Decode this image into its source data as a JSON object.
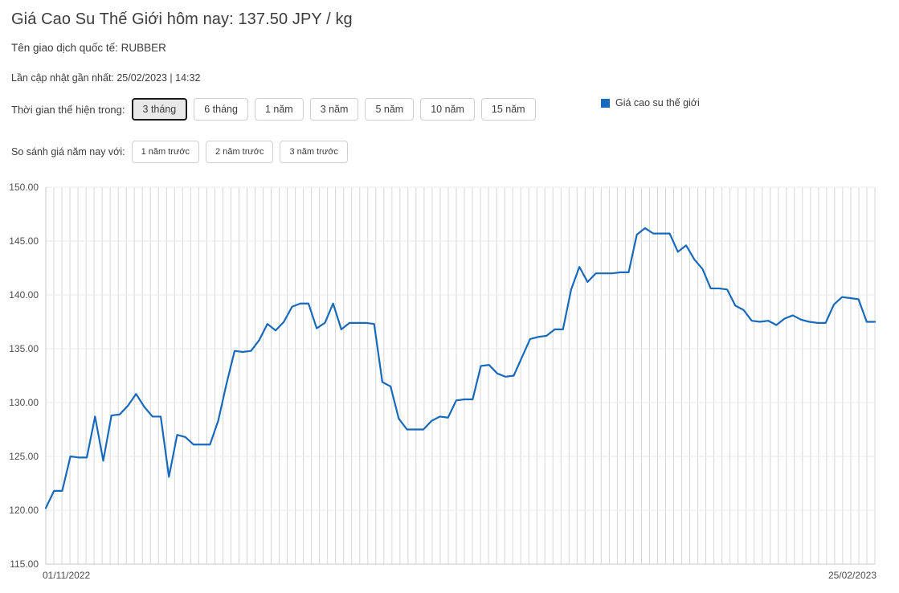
{
  "header": {
    "title": "Giá Cao Su Thế Giới hôm nay: 137.50 JPY / kg",
    "subtitle": "Tên giao dịch quốc tế: RUBBER",
    "updated": "Lần cập nhật gần nhất: 25/02/2023 | 14:32"
  },
  "controls": {
    "range_label": "Thời gian thể hiện trong:",
    "range_buttons": [
      {
        "label": "3 tháng",
        "active": true
      },
      {
        "label": "6 tháng",
        "active": false
      },
      {
        "label": "1 năm",
        "active": false
      },
      {
        "label": "3 năm",
        "active": false
      },
      {
        "label": "5 năm",
        "active": false
      },
      {
        "label": "10 năm",
        "active": false
      },
      {
        "label": "15 năm",
        "active": false
      }
    ],
    "compare_label": "So sánh giá năm nay với:",
    "compare_buttons": [
      {
        "label": "1 năm trước"
      },
      {
        "label": "2 năm trước"
      },
      {
        "label": "3 năm trước"
      }
    ]
  },
  "legend": {
    "series_label": "Giá cao su thế giới",
    "color": "#1769bc"
  },
  "chart_data": {
    "type": "line",
    "title": "",
    "xlabel": "",
    "ylabel": "",
    "ylim": [
      115.0,
      150.0
    ],
    "yticks": [
      "115.00",
      "120.00",
      "125.00",
      "130.00",
      "135.00",
      "140.00",
      "145.00",
      "150.00"
    ],
    "ytick_values": [
      115,
      120,
      125,
      130,
      135,
      140,
      145,
      150
    ],
    "xticks": [
      "01/11/2022",
      "25/02/2023"
    ],
    "grid": true,
    "grid_orientation": "vertical",
    "legend_position": "top-right",
    "line_color": "#1769bc",
    "line_width": 2.2,
    "series": [
      {
        "name": "Giá cao su thế giới",
        "unit": "JPY / kg",
        "values": [
          120.2,
          121.8,
          121.8,
          125.0,
          124.9,
          124.9,
          128.7,
          124.6,
          128.8,
          128.9,
          129.7,
          130.8,
          129.6,
          128.7,
          128.7,
          123.1,
          127.0,
          126.8,
          126.1,
          126.1,
          126.1,
          128.3,
          131.7,
          134.8,
          134.7,
          134.8,
          135.8,
          137.3,
          136.7,
          137.5,
          138.9,
          139.2,
          139.2,
          136.9,
          137.4,
          139.2,
          136.8,
          137.4,
          137.4,
          137.4,
          137.3,
          131.9,
          131.5,
          128.5,
          127.5,
          127.5,
          127.5,
          128.3,
          128.7,
          128.6,
          130.2,
          130.3,
          130.3,
          133.4,
          133.5,
          132.7,
          132.4,
          132.5,
          134.2,
          135.9,
          136.1,
          136.2,
          136.8,
          136.8,
          140.5,
          142.6,
          141.2,
          142.0,
          142.0,
          142.0,
          142.1,
          142.1,
          145.6,
          146.2,
          145.7,
          145.7,
          145.7,
          144.0,
          144.6,
          143.3,
          142.4,
          140.6,
          140.6,
          140.5,
          139.0,
          138.6,
          137.6,
          137.5,
          137.6,
          137.2,
          137.8,
          138.1,
          137.7,
          137.5,
          137.4,
          137.4,
          139.1,
          139.8,
          139.7,
          139.6,
          137.5,
          137.5
        ]
      }
    ],
    "start_date": "01/11/2022",
    "end_date": "25/02/2023",
    "current_value": 137.5
  }
}
